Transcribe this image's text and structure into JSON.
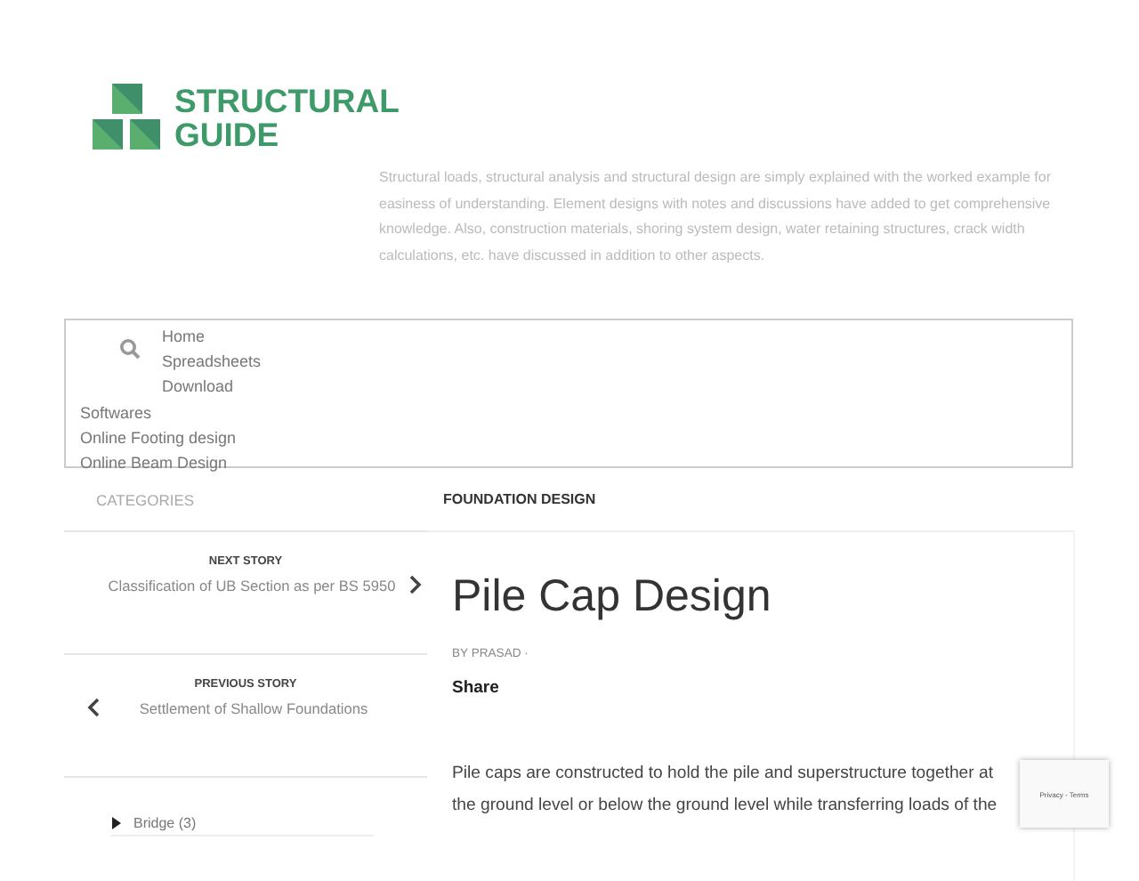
{
  "logo": {
    "line1": "STRUCTURAL",
    "line2": "GUIDE"
  },
  "tagline": "Structural loads, structural analysis and structural design are simply explained with the worked example for easiness of understanding. Element designs with notes and discussions have added to get comprehensive knowledge. Also, construction materials, shoring system design, water retaining structures, crack width calculations, etc. have discussed in addition to other aspects.",
  "nav": {
    "indented": [
      "Home",
      "Spreadsheets",
      "Download"
    ],
    "items": [
      "Softwares",
      "Online Footing design",
      "Online Beam Design"
    ]
  },
  "sidebar": {
    "heading": "CATEGORIES",
    "next": {
      "label": "NEXT STORY",
      "title": "Classification of UB Section as per BS 5950"
    },
    "previous": {
      "label": "PREVIOUS STORY",
      "title": "Settlement of Shallow Foundations"
    },
    "categories": [
      {
        "name": "Bridge (3)",
        "expanded": false
      }
    ]
  },
  "article": {
    "category": "FOUNDATION DESIGN",
    "title": "Pile Cap Design",
    "byline": "BY PRASAD ·",
    "share": "Share",
    "body": "Pile caps are constructed to hold the pile and superstructure together at the ground level or below the ground level while transferring loads of the"
  },
  "recaptcha": {
    "text": "Privacy - Terms"
  }
}
